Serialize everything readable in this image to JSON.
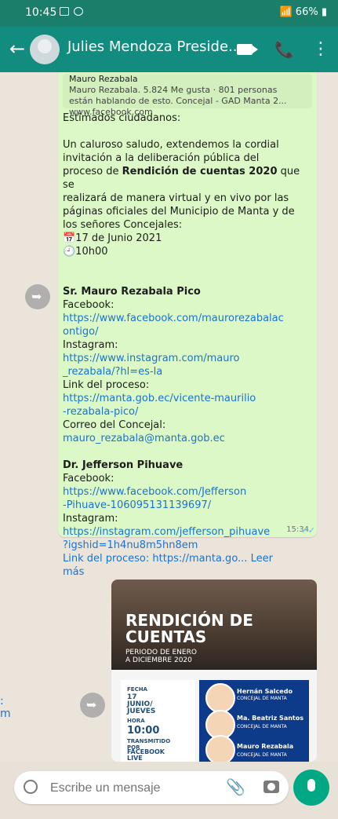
{
  "status": {
    "time": "10:45",
    "battery": "66%"
  },
  "header": {
    "title": "Julies Mendoza Preside..."
  },
  "preview": {
    "title": "Mauro Rezabala",
    "desc": "Mauro Rezabala. 5.824 Me gusta · 801 personas\nestán hablando de esto. Concejal - GAD Manta 2...\nwww.facebook.com"
  },
  "message": {
    "text": "Estimados ciudadanos:\n\nUn caluroso saludo, extendemos la cordial\ninvitación a la deliberación pública del\nproceso de Rendición de cuentas 2020 que se\nrealizará de manera virtual y en vivo por las\npáginas oficiales del Municipio de Manta y de\nlos señores Concejales:\n📅17 de Junio 2021\n🕘10h00\n\n\nSr. Mauro Rezabala Pico\nFacebook:\nhttps://www.facebook.com/maurorezabalac\nontigo/\nInstagram:\nhttps://www.instagram.com/mauro\n_rezabala/?hl=es-la\nLink del proceso:\nhttps://manta.gob.ec/vicente-maurilio\n-rezabala-pico/\nCorreo del Concejal:\nmauro_rezabala@manta.gob.ec\n\nDr. Jefferson Pihuave\nFacebook:\nhttps://www.facebook.com/Jefferson\n-Pihuave-106095131139697/\nInstagram:\nhttps://instagram.com/jefferson_pihuave\n?igshid=1h4nu8m5hn8em\nLink del proceso: https://manta.go... Leer\nmás",
    "time": "15:34"
  },
  "card": {
    "title": "RENDICIÓN DE\nCUENTAS",
    "subtitle": "PERIODO DE ENERO\nA DICIEMBRE 2020",
    "fecha_label": "FECHA",
    "fecha_value": "17\nJUNIO/\nJUEVES",
    "hora_label": "HORA",
    "hora_value": "10:00",
    "trans_label": "TRANSMITIDO\nPOR",
    "trans_value": "FACEBOOK\nLIVE",
    "people": [
      "Hernán Salcedo",
      "Ma. Beatriz Santos",
      "Mauro Rezabala"
    ],
    "role": "CONCEJAL DE MANTA"
  },
  "input": {
    "placeholder": "Escribe un mensaje"
  },
  "overlap_text": ":\nm\n"
}
